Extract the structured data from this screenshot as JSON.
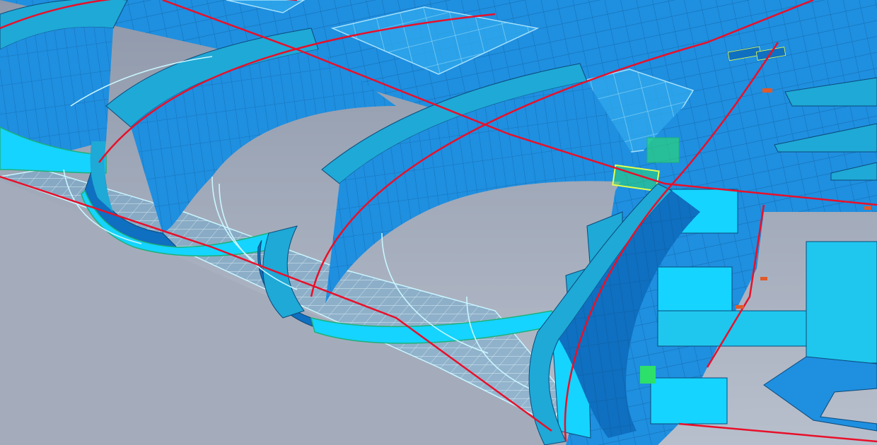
{
  "scene": {
    "description_visible_text": "",
    "colors": {
      "background_top": "#9aa3b4",
      "background_bottom": "#b6bcc9",
      "plate_blue": "#1f8fe0",
      "plate_cyan": "#15d4ff",
      "plate_teal": "#1fa9d6",
      "plate_deep": "#0f6fc0",
      "structure_dark": "#0b5a9e",
      "mesh_line": "#0b4a7a",
      "green_edge": "#1fb07a",
      "highlight_green": "#2de06a",
      "wireframe": "#c9f6ff",
      "centerline_red": "#e8102a",
      "selection_yellow": "#e7ff4a"
    }
  }
}
